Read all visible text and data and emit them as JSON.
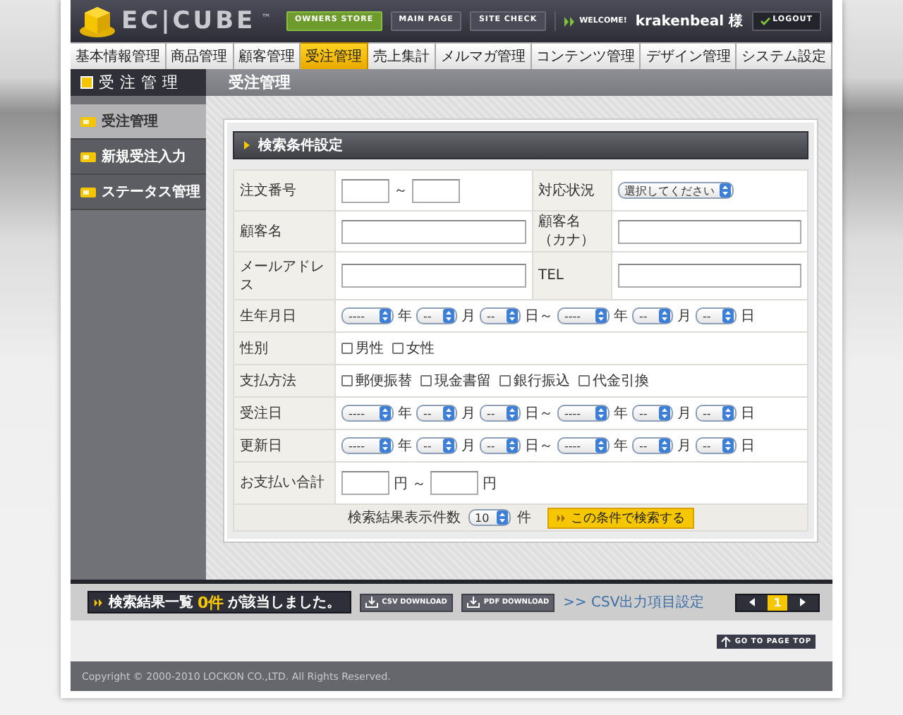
{
  "header": {
    "logo": "EC|CUBE",
    "trademark": "™",
    "buttons": [
      {
        "label": "OWNERS STORE",
        "kind": "highlight"
      },
      {
        "label": "MAIN PAGE",
        "kind": "plain"
      },
      {
        "label": "SITE CHECK",
        "kind": "plain"
      }
    ],
    "welcome": "WELCOME!",
    "user": "krakenbeal 様",
    "logout": "LOGOUT"
  },
  "nav": [
    {
      "label": "基本情報管理",
      "selected": false
    },
    {
      "label": "商品管理",
      "selected": false
    },
    {
      "label": "顧客管理",
      "selected": false
    },
    {
      "label": "受注管理",
      "selected": true
    },
    {
      "label": "売上集計",
      "selected": false
    },
    {
      "label": "メルマガ管理",
      "selected": false
    },
    {
      "label": "コンテンツ管理",
      "selected": false
    },
    {
      "label": "デザイン管理",
      "selected": false
    },
    {
      "label": "システム設定",
      "selected": false
    }
  ],
  "section_title": "受注管理",
  "page_title": "受注管理",
  "sidebar": [
    {
      "label": "受注管理",
      "selected": true
    },
    {
      "label": "新規受注入力",
      "selected": false
    },
    {
      "label": "ステータス管理",
      "selected": false
    }
  ],
  "search": {
    "title": "検索条件設定",
    "rows": [
      {
        "cells": [
          {
            "label": "注文番号",
            "control": {
              "kind": "range",
              "separator": "～"
            }
          },
          {
            "label": "対応状況",
            "control": {
              "kind": "select",
              "value": "選択してください"
            }
          }
        ]
      },
      {
        "cells": [
          {
            "label": "顧客名",
            "control": {
              "kind": "text"
            }
          },
          {
            "label": "顧客名（カナ）",
            "control": {
              "kind": "text"
            }
          }
        ]
      },
      {
        "cells": [
          {
            "label": "メールアドレス",
            "control": {
              "kind": "text"
            }
          },
          {
            "label": "TEL",
            "control": {
              "kind": "text"
            }
          }
        ]
      },
      {
        "cells": [
          {
            "label": "生年月日",
            "control": {
              "kind": "dates",
              "selects": [
                {
                  "value": "----",
                  "unit": "年"
                },
                {
                  "value": "--",
                  "unit": "月"
                },
                {
                  "value": "--",
                  "unit": "日～"
                },
                {
                  "value": "----",
                  "unit": "年"
                },
                {
                  "value": "--",
                  "unit": "月"
                },
                {
                  "value": "--",
                  "unit": "日"
                }
              ]
            }
          }
        ]
      },
      {
        "cells": [
          {
            "label": "性別",
            "control": {
              "kind": "checks",
              "options": [
                {
                  "label": "男性",
                  "checked": false
                },
                {
                  "label": "女性",
                  "checked": false
                }
              ]
            }
          }
        ]
      },
      {
        "cells": [
          {
            "label": "支払方法",
            "control": {
              "kind": "checks",
              "options": [
                {
                  "label": "郵便振替",
                  "checked": false
                },
                {
                  "label": "現金書留",
                  "checked": false
                },
                {
                  "label": "銀行振込",
                  "checked": false
                },
                {
                  "label": "代金引換",
                  "checked": false
                }
              ]
            }
          }
        ]
      },
      {
        "cells": [
          {
            "label": "受注日",
            "control": {
              "kind": "dates",
              "selects": [
                {
                  "value": "----",
                  "unit": "年"
                },
                {
                  "value": "--",
                  "unit": "月"
                },
                {
                  "value": "--",
                  "unit": "日～"
                },
                {
                  "value": "----",
                  "unit": "年"
                },
                {
                  "value": "--",
                  "unit": "月"
                },
                {
                  "value": "--",
                  "unit": "日"
                }
              ]
            }
          }
        ]
      },
      {
        "cells": [
          {
            "label": "更新日",
            "control": {
              "kind": "dates",
              "selects": [
                {
                  "value": "----",
                  "unit": "年"
                },
                {
                  "value": "--",
                  "unit": "月"
                },
                {
                  "value": "--",
                  "unit": "日～"
                },
                {
                  "value": "----",
                  "unit": "年"
                },
                {
                  "value": "--",
                  "unit": "月"
                },
                {
                  "value": "--",
                  "unit": "日"
                }
              ]
            }
          }
        ]
      },
      {
        "cells": [
          {
            "label": "お支払い合計",
            "control": {
              "kind": "range",
              "from_unit": "円",
              "separator": "～",
              "to_unit": "円"
            }
          }
        ]
      }
    ],
    "count_label": "検索結果表示件数",
    "count_value": "10",
    "count_unit": "件",
    "submit": "この条件で検索する"
  },
  "results": {
    "label": "検索結果一覧",
    "count": "0件",
    "text": "が該当しました。",
    "buttons": [
      "CSV DOWNLOAD",
      "PDF DOWNLOAD"
    ],
    "link": ">> CSV出力項目設定",
    "pages": [
      {
        "label": "1",
        "selected": true
      }
    ]
  },
  "page_top": "GO TO PAGE TOP",
  "copyright": "Copyright © 2000-2010 LOCKON CO.,LTD. All Rights Reserved."
}
